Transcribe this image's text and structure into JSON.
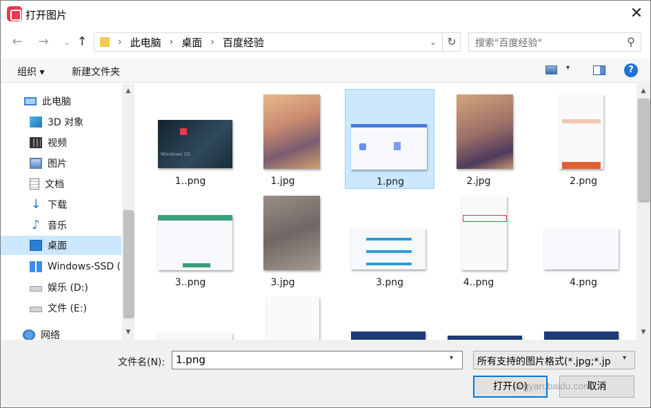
{
  "window": {
    "title": "打开图片",
    "close_glyph": "✕"
  },
  "nav_buttons": {
    "back": "←",
    "forward": "→",
    "recent": "⌄",
    "up": "↑"
  },
  "address": {
    "crumbs": [
      "此电脑",
      "桌面",
      "百度经验"
    ],
    "separator": "›",
    "dropdown": "⌄",
    "refresh": "↻"
  },
  "search": {
    "placeholder": "搜索\"百度经验\"",
    "icon": "⚲"
  },
  "toolbar": {
    "organize": "组织 ▾",
    "new_folder": "新建文件夹",
    "view_dd": "▾",
    "help": "?"
  },
  "nav_pane": {
    "items": [
      {
        "label": "此电脑",
        "icon": "pc-icon"
      },
      {
        "label": "3D 对象",
        "icon": "3d-objects-icon"
      },
      {
        "label": "视频",
        "icon": "video-icon"
      },
      {
        "label": "图片",
        "icon": "pictures-icon"
      },
      {
        "label": "文档",
        "icon": "documents-icon"
      },
      {
        "label": "下载",
        "icon": "downloads-icon"
      },
      {
        "label": "音乐",
        "icon": "music-icon"
      },
      {
        "label": "桌面",
        "icon": "desktop-icon",
        "selected": true
      },
      {
        "label": "Windows-SSD (",
        "icon": "windows-drive-icon"
      },
      {
        "label": "娱乐 (D:)",
        "icon": "drive-icon"
      },
      {
        "label": "文件 (E:)",
        "icon": "drive-icon"
      },
      {
        "label": "网络",
        "icon": "network-icon"
      }
    ],
    "glyphs": {
      "down_arrow": "↓",
      "note": "♪"
    }
  },
  "files": [
    {
      "name": "1..png",
      "style": "dark",
      "thumb_text": "Windows 10"
    },
    {
      "name": "1.jpg",
      "style": "paper"
    },
    {
      "name": "1.png",
      "style": "white",
      "selected": true
    },
    {
      "name": "2.jpg",
      "style": "paper2"
    },
    {
      "name": "2.png",
      "style": "phone"
    },
    {
      "name": "3..png",
      "style": "white-green"
    },
    {
      "name": "3.jpg",
      "style": "gray"
    },
    {
      "name": "3.png",
      "style": "white-blue"
    },
    {
      "name": "4..png",
      "style": "phone-red"
    },
    {
      "name": "4.png",
      "style": "white-list"
    },
    {
      "name": "",
      "style": "white"
    },
    {
      "name": "",
      "style": "phone"
    },
    {
      "name": "",
      "style": "blue"
    },
    {
      "name": "",
      "style": "blue"
    },
    {
      "name": "",
      "style": "blue"
    }
  ],
  "scroll_glyphs": {
    "up": "▲",
    "down": "▼"
  },
  "bottom": {
    "filename_label": "文件名(N):",
    "filename_value": "1.png",
    "dropdown": "▾",
    "filter_value": "所有支持的图片格式(*.jpg;*.jp",
    "open_button": "打开(O)",
    "cancel_button": "取消",
    "watermark": "jingyan.baidu.com"
  }
}
